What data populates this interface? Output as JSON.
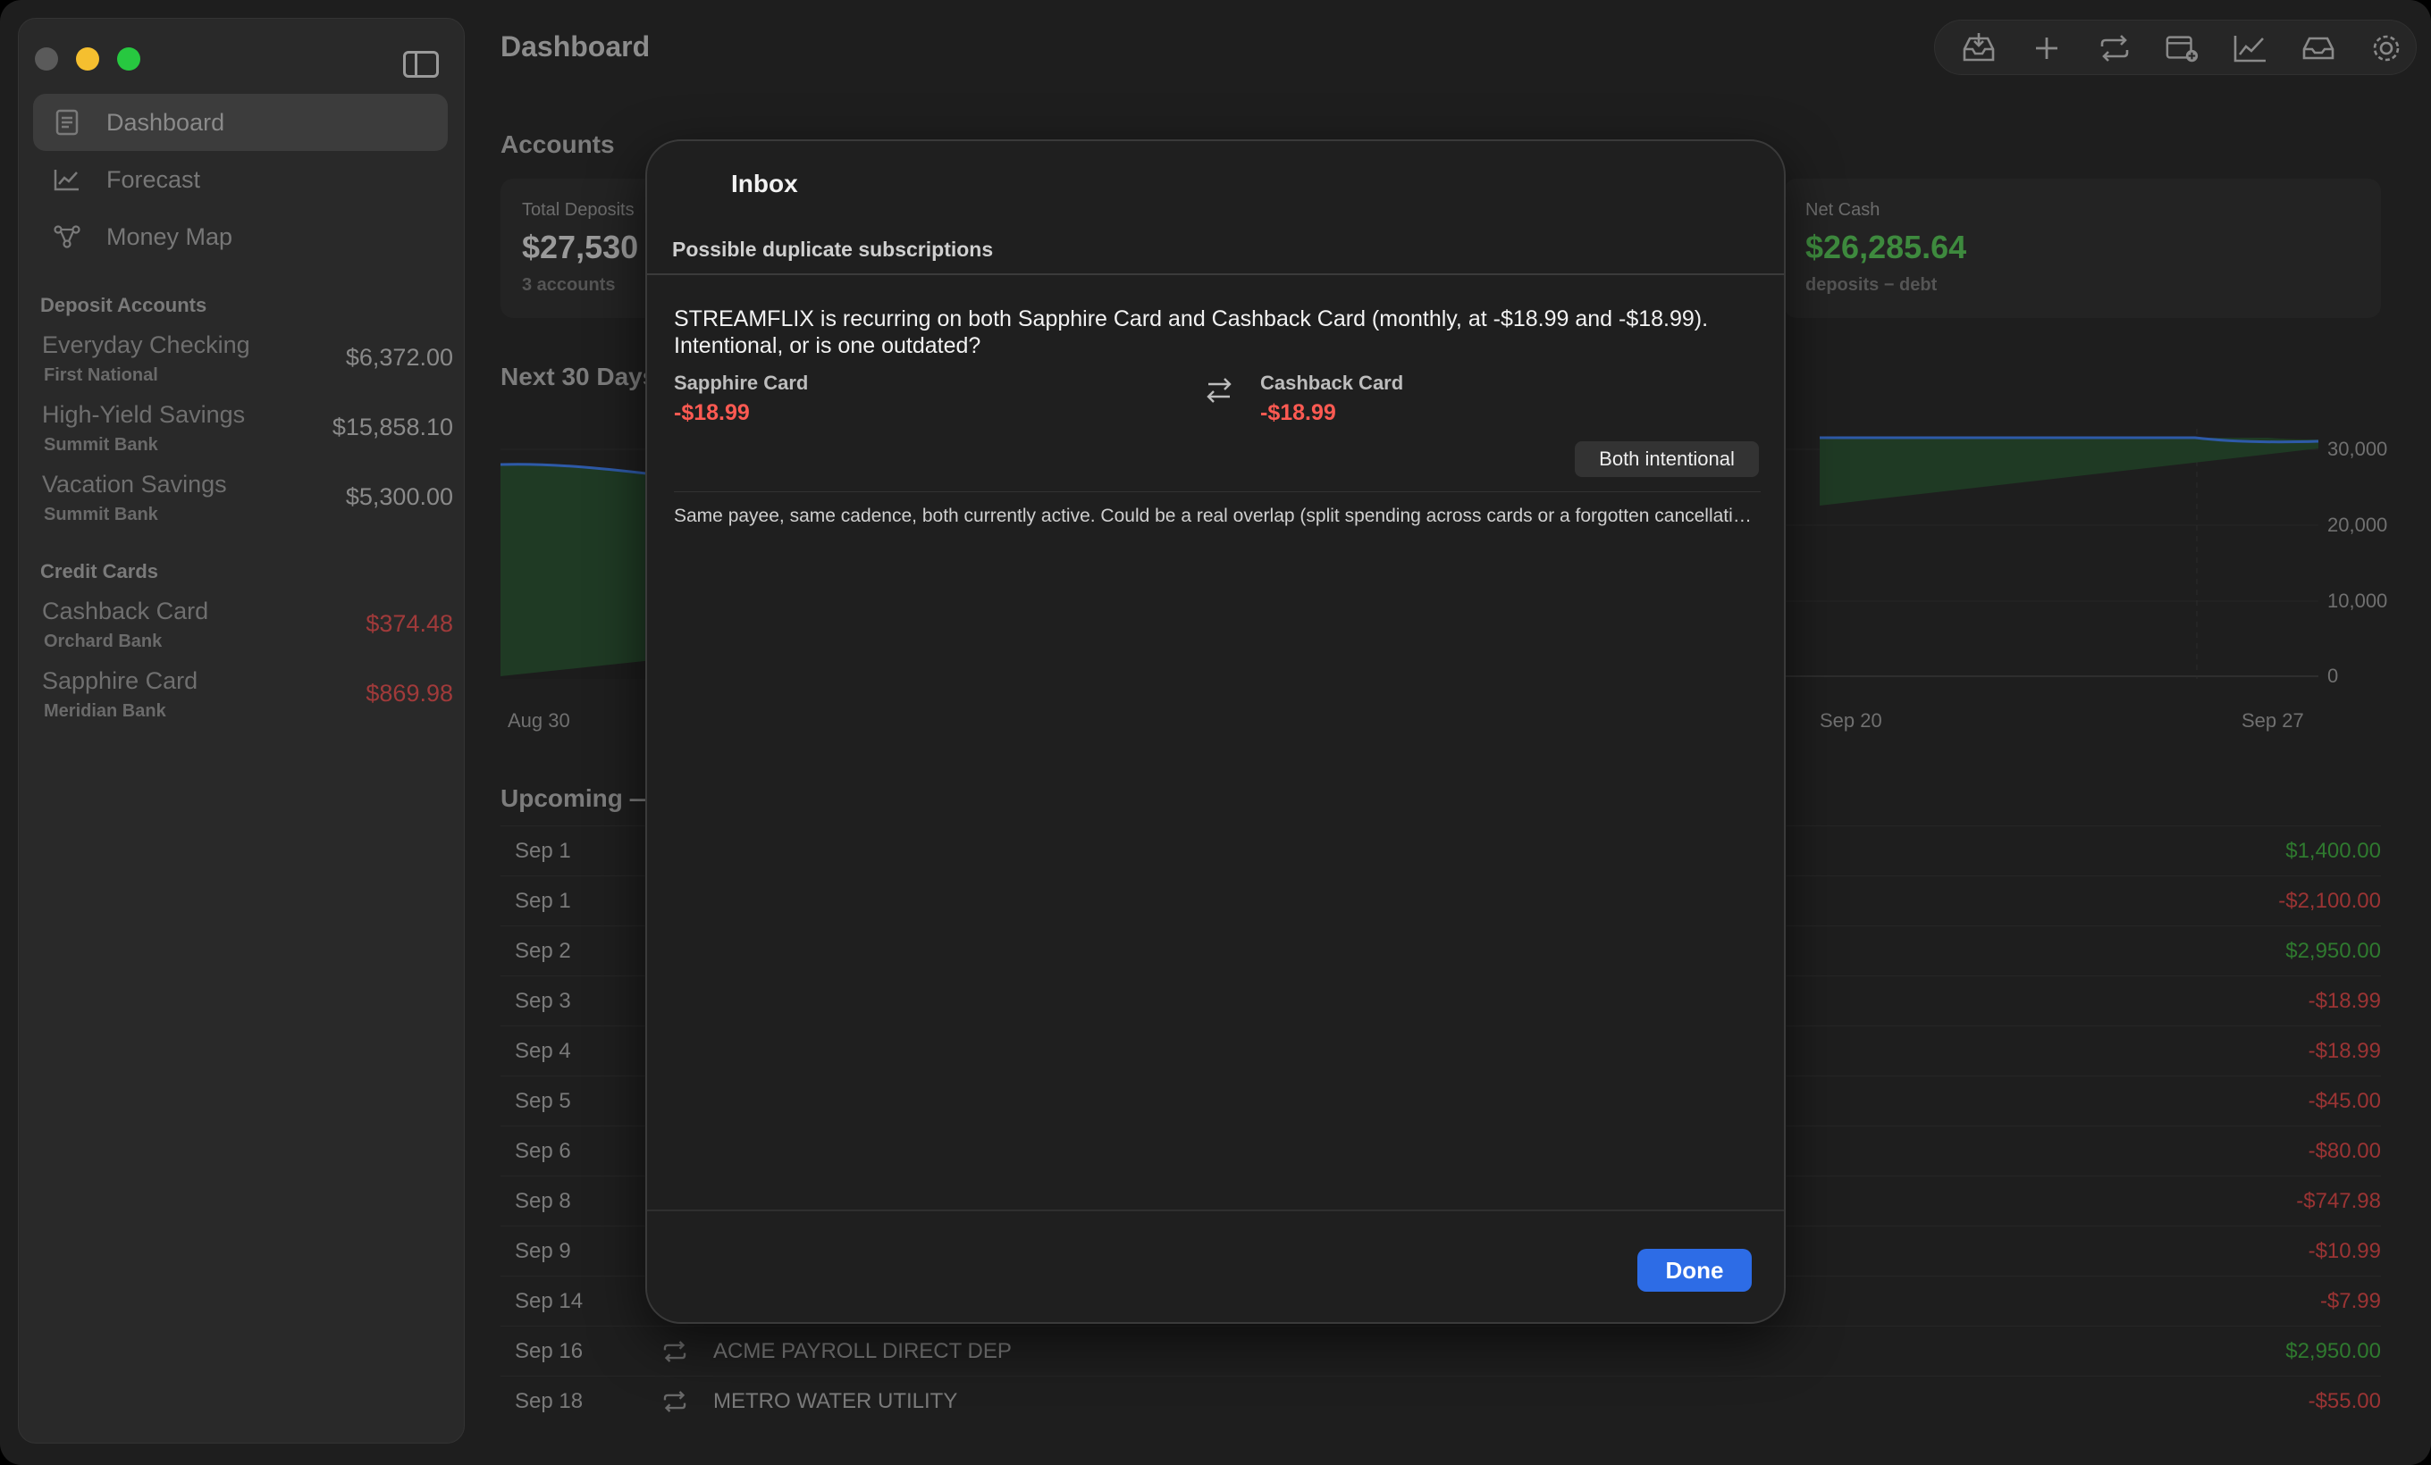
{
  "sidebar": {
    "nav": [
      {
        "label": "Dashboard",
        "icon": "document-icon",
        "active": true
      },
      {
        "label": "Forecast",
        "icon": "trend-icon",
        "active": false
      },
      {
        "label": "Money Map",
        "icon": "network-icon",
        "active": false
      }
    ],
    "deposit_header": "Deposit Accounts",
    "deposit_accounts": [
      {
        "name": "Everyday Checking",
        "bank": "First National",
        "balance": "$6,372.00"
      },
      {
        "name": "High-Yield Savings",
        "bank": "Summit Bank",
        "balance": "$15,858.10"
      },
      {
        "name": "Vacation Savings",
        "bank": "Summit Bank",
        "balance": "$5,300.00"
      }
    ],
    "credit_header": "Credit Cards",
    "credit_cards": [
      {
        "name": "Cashback Card",
        "bank": "Orchard Bank",
        "balance": "$374.48"
      },
      {
        "name": "Sapphire Card",
        "bank": "Meridian Bank",
        "balance": "$869.98"
      }
    ]
  },
  "main": {
    "title": "Dashboard",
    "toolbar_icons": [
      "inbox-icon",
      "plus-icon",
      "recurring-icon",
      "calendar-add-icon",
      "chart-icon",
      "tray-icon",
      "gear-icon"
    ],
    "accounts_title": "Accounts",
    "cards": [
      {
        "label": "Total Deposits",
        "value": "$27,530",
        "sub": "3 accounts"
      },
      {
        "label": "Net Cash",
        "value": "$26,285.64",
        "sub": "deposits − debt"
      }
    ],
    "next30_title": "Next 30 Days",
    "chart": {
      "y_ticks": [
        "30,000",
        "20,000",
        "10,000",
        "0"
      ],
      "x_ticks": [
        "Aug 30",
        "Sep 20",
        "Sep 27"
      ]
    },
    "upcoming_title": "Upcoming —",
    "upcoming": [
      {
        "date": "Sep 1",
        "payee": "",
        "amount": "$1,400.00",
        "sign": "pos"
      },
      {
        "date": "Sep 1",
        "payee": "",
        "amount": "-$2,100.00",
        "sign": "neg"
      },
      {
        "date": "Sep 2",
        "payee": "",
        "amount": "$2,950.00",
        "sign": "pos"
      },
      {
        "date": "Sep 3",
        "payee": "",
        "amount": "-$18.99",
        "sign": "neg"
      },
      {
        "date": "Sep 4",
        "payee": "",
        "amount": "-$18.99",
        "sign": "neg"
      },
      {
        "date": "Sep 5",
        "payee": "",
        "amount": "-$45.00",
        "sign": "neg"
      },
      {
        "date": "Sep 6",
        "payee": "",
        "amount": "-$80.00",
        "sign": "neg"
      },
      {
        "date": "Sep 8",
        "payee": "",
        "amount": "-$747.98",
        "sign": "neg"
      },
      {
        "date": "Sep 9",
        "payee": "",
        "amount": "-$10.99",
        "sign": "neg"
      },
      {
        "date": "Sep 14",
        "payee": "",
        "amount": "-$7.99",
        "sign": "neg"
      },
      {
        "date": "Sep 16",
        "payee": "ACME PAYROLL DIRECT DEP",
        "amount": "$2,950.00",
        "sign": "pos"
      },
      {
        "date": "Sep 18",
        "payee": "METRO WATER UTILITY",
        "amount": "-$55.00",
        "sign": "neg"
      }
    ]
  },
  "modal": {
    "title": "Inbox",
    "section": "Possible duplicate subscriptions",
    "message": "STREAMFLIX is recurring on both Sapphire Card and Cashback Card (monthly, at -$18.99 and -$18.99). Intentional, or is one outdated?",
    "left_account": "Sapphire Card",
    "left_amount": "-$18.99",
    "right_account": "Cashback Card",
    "right_amount": "-$18.99",
    "both_intentional_label": "Both intentional",
    "explanation": "Same payee, same cadence, both currently active. Could be a real overlap (split spending across cards or a forgotten cancellation).",
    "done_label": "Done"
  },
  "colors": {
    "accent": "#2d6ce6",
    "negative": "#ff5a52",
    "positive": "#3e8a3e"
  }
}
